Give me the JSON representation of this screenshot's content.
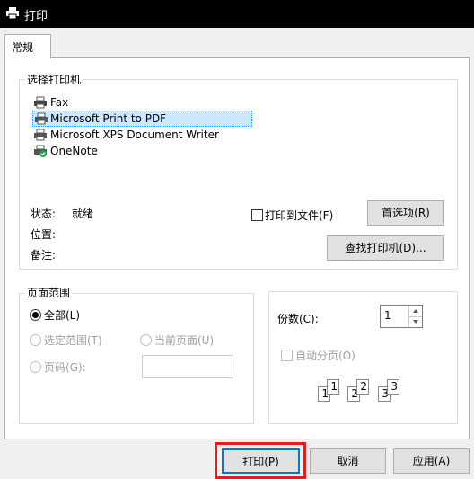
{
  "window": {
    "title": "打印"
  },
  "tabs": [
    {
      "label": "常规"
    }
  ],
  "printer_group": {
    "label": "选择打印机",
    "printers": [
      {
        "name": "Fax",
        "icon": "fax-icon"
      },
      {
        "name": "Microsoft Print to PDF",
        "icon": "printer-icon",
        "selected": true
      },
      {
        "name": "Microsoft XPS Document Writer",
        "icon": "printer-icon"
      },
      {
        "name": "OneNote",
        "icon": "onenote-printer-icon"
      }
    ],
    "status_label": "状态:",
    "status_value": "就绪",
    "location_label": "位置:",
    "comment_label": "备注:",
    "print_to_file_label": "打印到文件(F)",
    "preferences_button": "首选项(R)",
    "find_printer_button": "查找打印机(D)..."
  },
  "page_range": {
    "label": "页面范围",
    "all": "全部(L)",
    "selection": "选定范围(T)",
    "current_page": "当前页面(U)",
    "pages": "页码(G):",
    "pages_value": ""
  },
  "copies": {
    "label": "份数(C):",
    "value": "1",
    "collate_label": "自动分页(O)",
    "collate_numbers": [
      "1",
      "1",
      "2",
      "2",
      "3",
      "3"
    ]
  },
  "footer": {
    "print_button": "打印(P)",
    "cancel_button": "取消",
    "apply_button": "应用(A)",
    "highlight_color": "#e02020"
  }
}
